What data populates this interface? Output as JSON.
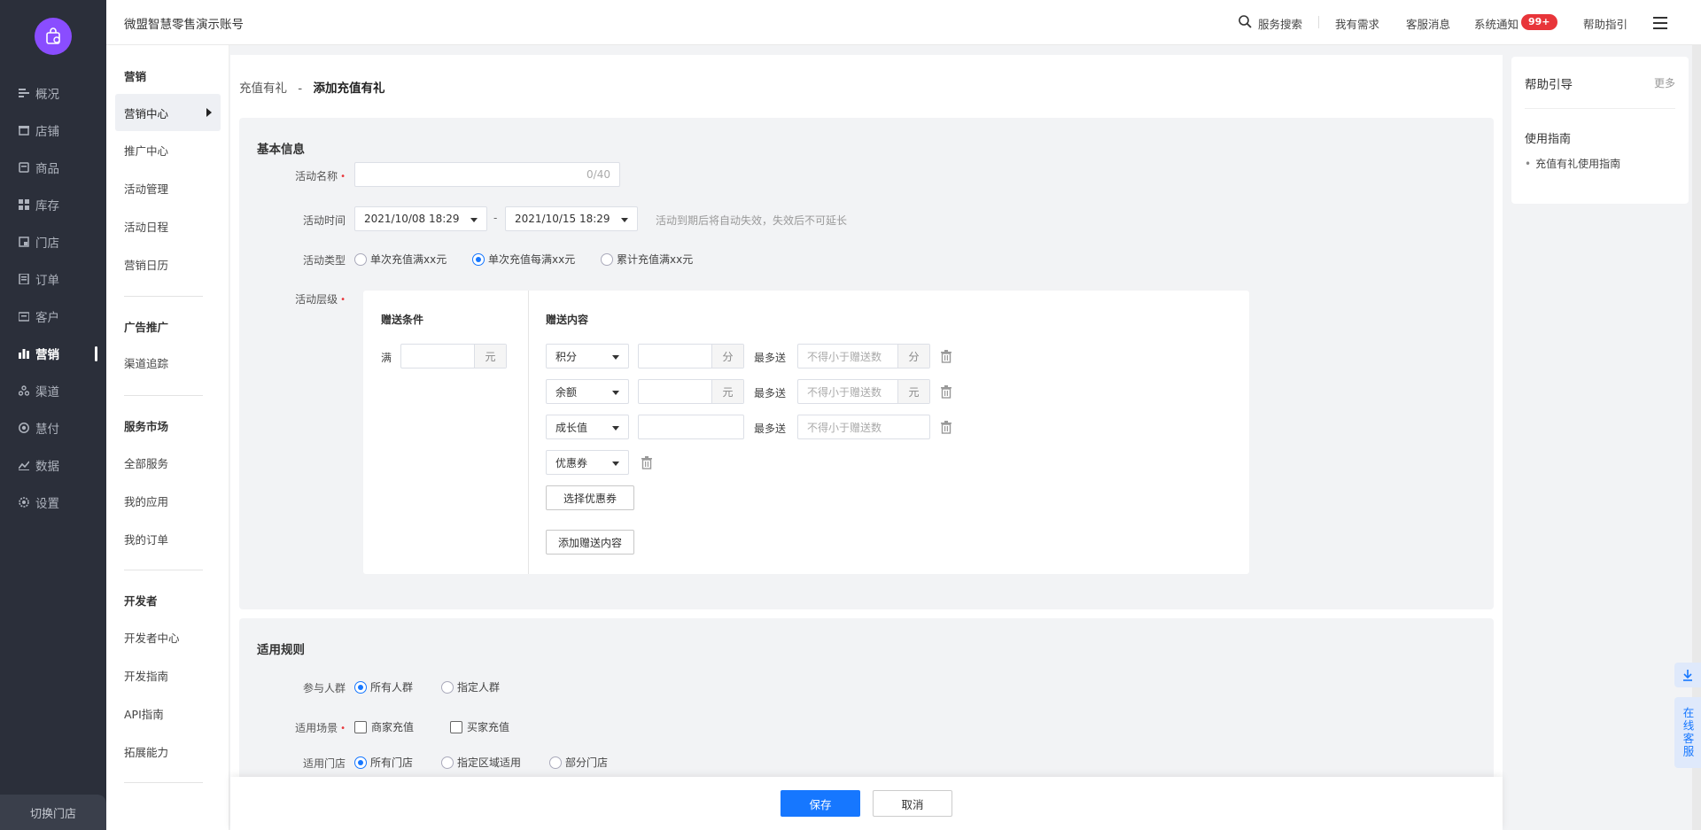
{
  "nav": {
    "items": [
      {
        "label": "概况",
        "icon": "overview-icon"
      },
      {
        "label": "店铺",
        "icon": "shop-icon"
      },
      {
        "label": "商品",
        "icon": "goods-icon"
      },
      {
        "label": "库存",
        "icon": "inventory-icon"
      },
      {
        "label": "门店",
        "icon": "store-icon"
      },
      {
        "label": "订单",
        "icon": "order-icon"
      },
      {
        "label": "客户",
        "icon": "customer-icon"
      },
      {
        "label": "营销",
        "icon": "marketing-icon"
      },
      {
        "label": "渠道",
        "icon": "channel-icon"
      },
      {
        "label": "慧付",
        "icon": "pay-icon"
      },
      {
        "label": "数据",
        "icon": "data-icon"
      },
      {
        "label": "设置",
        "icon": "settings-icon"
      }
    ],
    "active": "营销",
    "switch_store": "切换门店"
  },
  "subnav": {
    "groups": [
      {
        "title": "营销",
        "links": [
          "营销中心",
          "推广中心",
          "活动管理",
          "活动日程",
          "营销日历"
        ]
      },
      {
        "title": "广告推广",
        "links": [
          "渠道追踪"
        ]
      },
      {
        "title": "服务市场",
        "links": [
          "全部服务",
          "我的应用",
          "我的订单"
        ]
      },
      {
        "title": "开发者",
        "links": [
          "开发者中心",
          "开发指南",
          "API指南",
          "拓展能力"
        ]
      }
    ],
    "active_link": "营销中心"
  },
  "topbar": {
    "account": "微盟智慧零售演示账号",
    "service_search": "服务搜索",
    "my_needs": "我有需求",
    "cs_messages": "客服消息",
    "system_notice": "系统通知",
    "notice_badge": "99+",
    "help_guide": "帮助指引"
  },
  "breadcrumb": {
    "parent": "充值有礼",
    "separator": "-",
    "current": "添加充值有礼"
  },
  "basic": {
    "title": "基本信息",
    "name_label": "活动名称",
    "name_counter": "0/40",
    "time_label": "活动时间",
    "start_time": "2021/10/08 18:29",
    "end_time": "2021/10/15 18:29",
    "time_dash": "-",
    "time_hint": "活动到期后将自动失效，失效后不可延长",
    "type_label": "活动类型",
    "types": [
      "单次充值满xx元",
      "单次充值每满xx元",
      "累计充值满xx元"
    ],
    "type_selected": 1,
    "tier_label": "活动层级",
    "tier": {
      "cond_header": "赠送条件",
      "content_header": "赠送内容",
      "cond_prefix": "满",
      "cond_unit": "元",
      "max_label": "最多送",
      "max_placeholder": "不得小于赠送数",
      "rows": [
        {
          "type": "积分",
          "unit": "分",
          "max_unit": "分"
        },
        {
          "type": "余额",
          "unit": "元",
          "max_unit": "元"
        },
        {
          "type": "成长值",
          "unit": "",
          "max_unit": ""
        },
        {
          "type": "优惠券"
        }
      ],
      "choose_coupon": "选择优惠券",
      "add_content": "添加赠送内容"
    }
  },
  "rules": {
    "title": "适用规则",
    "crowd_label": "参与人群",
    "crowd_options": [
      "所有人群",
      "指定人群"
    ],
    "crowd_selected": 0,
    "scene_label": "适用场景",
    "scene_options": [
      "商家充值",
      "买家充值"
    ],
    "store_label": "适用门店",
    "store_options": [
      "所有门店",
      "指定区域适用",
      "部分门店"
    ],
    "store_selected": 0
  },
  "help": {
    "title": "帮助引导",
    "more": "更多",
    "guide_title": "使用指南",
    "links": [
      "充值有礼使用指南"
    ]
  },
  "float": {
    "online_service": "在线客服"
  },
  "actions": {
    "save": "保存",
    "cancel": "取消"
  },
  "colors": {
    "nav_bg": "#2b2f3a",
    "accent": "#1677ff",
    "badge": "#e8353a",
    "logo": "#8a4dff"
  }
}
